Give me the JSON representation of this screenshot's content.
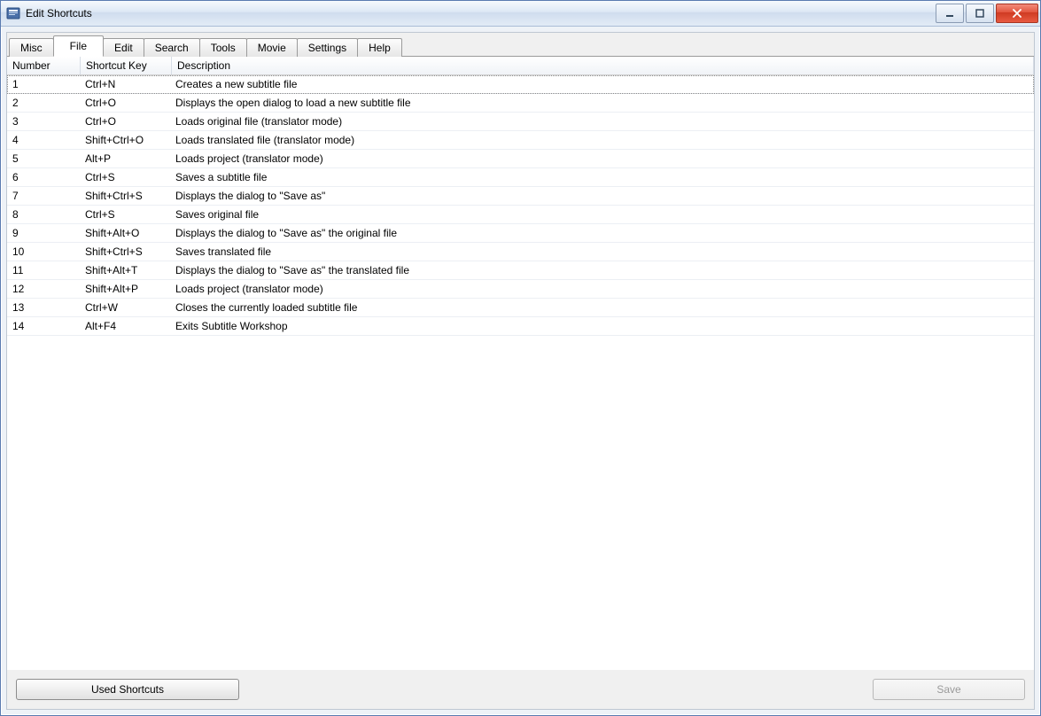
{
  "window": {
    "title": "Edit Shortcuts"
  },
  "tabs": [
    {
      "label": "Misc"
    },
    {
      "label": "File"
    },
    {
      "label": "Edit"
    },
    {
      "label": "Search"
    },
    {
      "label": "Tools"
    },
    {
      "label": "Movie"
    },
    {
      "label": "Settings"
    },
    {
      "label": "Help"
    }
  ],
  "active_tab_index": 1,
  "columns": {
    "number": "Number",
    "shortcut_key": "Shortcut Key",
    "description": "Description"
  },
  "rows": [
    {
      "num": "1",
      "key": "Ctrl+N",
      "desc": "Creates a new subtitle file"
    },
    {
      "num": "2",
      "key": "Ctrl+O",
      "desc": "Displays the open dialog to load a new subtitle file"
    },
    {
      "num": "3",
      "key": "Ctrl+O",
      "desc": "Loads original file (translator mode)"
    },
    {
      "num": "4",
      "key": "Shift+Ctrl+O",
      "desc": "Loads translated file (translator mode)"
    },
    {
      "num": "5",
      "key": "Alt+P",
      "desc": "Loads project (translator mode)"
    },
    {
      "num": "6",
      "key": "Ctrl+S",
      "desc": "Saves a subtitle file"
    },
    {
      "num": "7",
      "key": "Shift+Ctrl+S",
      "desc": "Displays the dialog to \"Save as\""
    },
    {
      "num": "8",
      "key": "Ctrl+S",
      "desc": "Saves original file"
    },
    {
      "num": "9",
      "key": "Shift+Alt+O",
      "desc": "Displays the dialog to \"Save as\" the original file"
    },
    {
      "num": "10",
      "key": "Shift+Ctrl+S",
      "desc": "Saves translated file"
    },
    {
      "num": "11",
      "key": "Shift+Alt+T",
      "desc": "Displays the dialog to \"Save as\" the translated file"
    },
    {
      "num": "12",
      "key": "Shift+Alt+P",
      "desc": "Loads project (translator mode)"
    },
    {
      "num": "13",
      "key": "Ctrl+W",
      "desc": "Closes the currently loaded subtitle file"
    },
    {
      "num": "14",
      "key": "Alt+F4",
      "desc": "Exits Subtitle Workshop"
    }
  ],
  "selected_row_index": 0,
  "buttons": {
    "used_shortcuts": "Used Shortcuts",
    "save": "Save"
  }
}
